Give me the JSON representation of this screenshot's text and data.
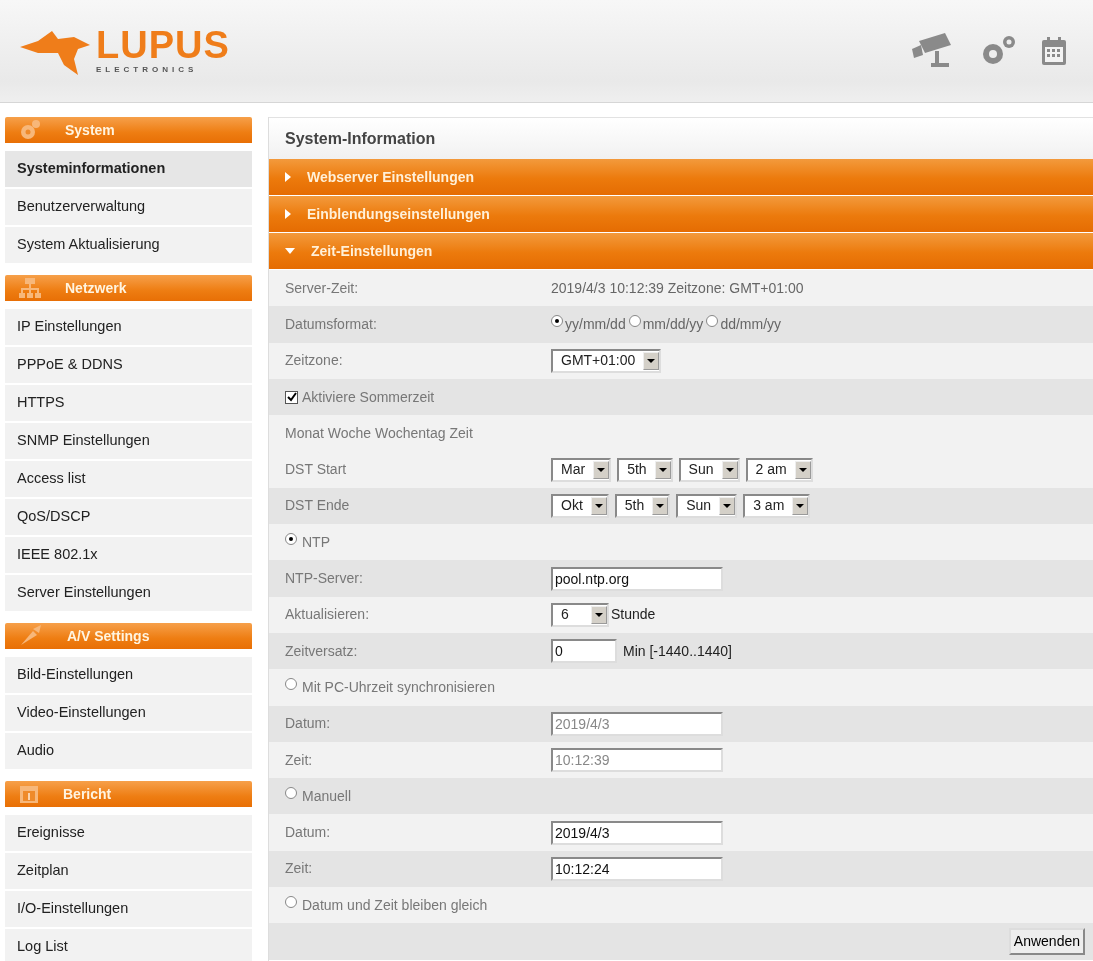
{
  "logo": {
    "name": "LUPUS",
    "tagline": "ELECTRONICS"
  },
  "sidebar": {
    "sections": [
      {
        "title": "System",
        "items": [
          {
            "label": "Systeminformationen",
            "selected": true
          },
          {
            "label": "Benutzerverwaltung",
            "selected": false
          },
          {
            "label": "System Aktualisierung",
            "selected": false
          }
        ]
      },
      {
        "title": "Netzwerk",
        "items": [
          {
            "label": "IP Einstellungen",
            "selected": false
          },
          {
            "label": "PPPoE & DDNS",
            "selected": false
          },
          {
            "label": "HTTPS",
            "selected": false
          },
          {
            "label": "SNMP Einstellungen",
            "selected": false
          },
          {
            "label": "Access list",
            "selected": false
          },
          {
            "label": "QoS/DSCP",
            "selected": false
          },
          {
            "label": "IEEE 802.1x",
            "selected": false
          },
          {
            "label": "Server Einstellungen",
            "selected": false
          }
        ]
      },
      {
        "title": "A/V Settings",
        "items": [
          {
            "label": "Bild-Einstellungen",
            "selected": false
          },
          {
            "label": "Video-Einstellungen",
            "selected": false
          },
          {
            "label": "Audio",
            "selected": false
          }
        ]
      },
      {
        "title": "Bericht",
        "items": [
          {
            "label": "Ereignisse",
            "selected": false
          },
          {
            "label": "Zeitplan",
            "selected": false
          },
          {
            "label": "I/O-Einstellungen",
            "selected": false
          },
          {
            "label": "Log List",
            "selected": false
          }
        ]
      }
    ]
  },
  "panel": {
    "title": "System-Information",
    "sections": [
      {
        "title": "Webserver Einstellungen",
        "expanded": false
      },
      {
        "title": "Einblendungseinstellungen",
        "expanded": false
      },
      {
        "title": "Zeit-Einstellungen",
        "expanded": true
      }
    ],
    "rows": [
      {
        "kind": "text",
        "label": "Server-Zeit:",
        "value": "2019/4/3 10:12:39 Zeitzone: GMT+01:00"
      },
      {
        "kind": "radios",
        "label": "Datumsformat:",
        "options": [
          {
            "label": "yy/mm/dd",
            "selected": true
          },
          {
            "label": "mm/dd/yy",
            "selected": false
          },
          {
            "label": "dd/mm/yy",
            "selected": false
          }
        ]
      },
      {
        "kind": "selects",
        "label": "Zeitzone:",
        "selects": [
          "GMT+01:00"
        ]
      },
      {
        "kind": "checkbox",
        "label": "Aktiviere Sommerzeit",
        "checked": true
      },
      {
        "kind": "note",
        "label": "Monat Woche Wochentag Zeit"
      },
      {
        "kind": "selects",
        "label": "DST Start",
        "selects": [
          "Mar",
          "5th",
          "Sun",
          "2 am"
        ]
      },
      {
        "kind": "selects",
        "label": "DST Ende",
        "selects": [
          "Okt",
          "5th",
          "Sun",
          "3 am"
        ]
      },
      {
        "kind": "mode",
        "label": "NTP",
        "selected": true
      },
      {
        "kind": "input",
        "label": "NTP-Server:",
        "value": "pool.ntp.org",
        "disabled": false
      },
      {
        "kind": "selects",
        "label": "Aktualisieren:",
        "selects": [
          "6"
        ],
        "suffix": "Stunde"
      },
      {
        "kind": "input",
        "label": "Zeitversatz:",
        "value": "0",
        "disabled": false,
        "suffix": "Min [-1440..1440]"
      },
      {
        "kind": "mode",
        "label": "Mit PC-Uhrzeit synchronisieren",
        "selected": false
      },
      {
        "kind": "input",
        "label": "Datum:",
        "value": "2019/4/3",
        "disabled": true
      },
      {
        "kind": "input",
        "label": "Zeit:",
        "value": "10:12:39",
        "disabled": true
      },
      {
        "kind": "mode",
        "label": "Manuell",
        "selected": false
      },
      {
        "kind": "input",
        "label": "Datum:",
        "value": "2019/4/3",
        "disabled": false
      },
      {
        "kind": "input",
        "label": "Zeit:",
        "value": "10:12:24",
        "disabled": false
      },
      {
        "kind": "mode",
        "label": "Datum und Zeit bleiben gleich",
        "selected": false
      }
    ],
    "apply_button": "Anwenden"
  }
}
